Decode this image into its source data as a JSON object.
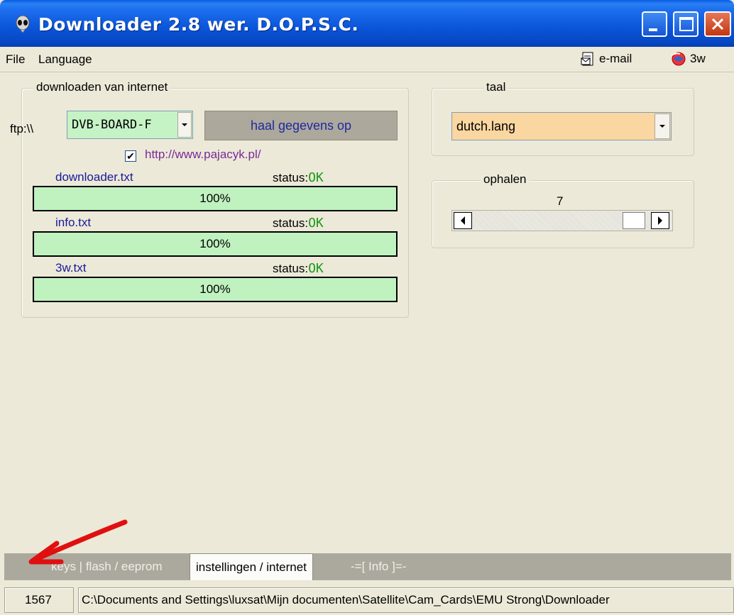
{
  "window": {
    "title": "Downloader 2.8 wer. D.O.P.S.C."
  },
  "menu": {
    "file": "File",
    "language": "Language",
    "email": "e-mail",
    "www": "3w"
  },
  "download_group": {
    "title": "downloaden van internet",
    "ftp_prefix": "ftp:\\\\",
    "server_value": "DVB-BOARD-F",
    "fetch_button": "haal gegevens op",
    "url_checked": true,
    "url": "http://www.pajacyk.pl/",
    "status_label": "status:",
    "files": [
      {
        "name": "downloader.txt",
        "status": "OK",
        "progress_label": "100%",
        "progress": 1.0
      },
      {
        "name": "info.txt",
        "status": "OK",
        "progress_label": "100%",
        "progress": 1.0
      },
      {
        "name": "3w.txt",
        "status": "OK",
        "progress_label": "100%",
        "progress": 1.0
      }
    ]
  },
  "language_group": {
    "title": "taal",
    "value": "dutch.lang"
  },
  "fetch_group": {
    "title": "ophalen",
    "value": "7"
  },
  "tabs": [
    {
      "label": "keys | flash / eeprom",
      "active": false
    },
    {
      "label": "instellingen / internet",
      "active": true
    },
    {
      "label": "-=[ Info ]=-",
      "active": false
    }
  ],
  "statusbar": {
    "count": "1567",
    "path": "C:\\Documents and Settings\\luxsat\\Mijn documenten\\Satellite\\Cam_Cards\\EMU Strong\\Downloader"
  },
  "colors": {
    "titlebar": "#0a55d8",
    "progress_fill": "#c0f2c0",
    "combo_green": "#c6f3c6",
    "combo_orange": "#fad6a0",
    "status_ok": "#1a9a1a",
    "link": "#7a2a9a",
    "annotation_arrow": "#e01010"
  }
}
